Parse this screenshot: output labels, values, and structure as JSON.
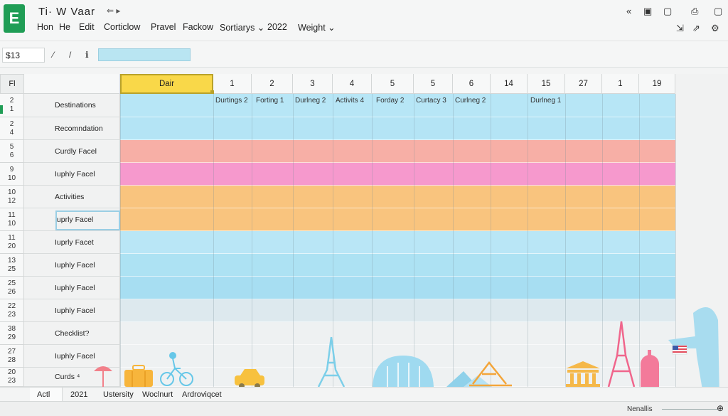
{
  "app": {
    "logo_letter": "E",
    "doc_title": "Ti· W  Vaar",
    "title_arrow": "⇐  ▸"
  },
  "menu": [
    {
      "label": "Hon"
    },
    {
      "label": "He"
    },
    {
      "label": "Edit"
    },
    {
      "label": "Corticlow"
    },
    {
      "label": "Pravel"
    },
    {
      "label": "Fackow"
    },
    {
      "label": "Sortiarys ⌄"
    },
    {
      "label": "2022"
    },
    {
      "label": "Weight ⌄"
    }
  ],
  "window_controls": [
    "«",
    "▣",
    "▢",
    "⎙",
    "▢"
  ],
  "right_tools": [
    "⇲",
    "⇗",
    "⚙"
  ],
  "formula_bar": {
    "cell_ref": "$13",
    "icons": [
      "⁄",
      "/",
      "ℹ"
    ],
    "value": ""
  },
  "columns": {
    "corner": "Fl",
    "a": "",
    "headers": [
      "Dair",
      "1",
      "2",
      "3",
      "4",
      "5",
      "5",
      "6",
      "14",
      "15",
      "27",
      "1",
      "19"
    ]
  },
  "row_headers": [
    [
      "2",
      "1"
    ],
    [
      "2",
      "4"
    ],
    [
      "5",
      "6"
    ],
    [
      "9",
      "10"
    ],
    [
      "10",
      "12"
    ],
    [
      "11",
      "10"
    ],
    [
      "11",
      "20"
    ],
    [
      "13",
      "25"
    ],
    [
      "25",
      "26"
    ],
    [
      "22",
      "23"
    ],
    [
      "38",
      "29"
    ],
    [
      "27",
      "28"
    ],
    [
      "20",
      "23"
    ]
  ],
  "row_labels": [
    "Destinations",
    "Recomndation",
    "Curdly Facel",
    "Iuphly Facel",
    "Activities",
    "Iuprly Facel",
    "Iuprly Facet",
    "Iuphly Facel",
    "Iuphly Facel",
    "Iuphly Facel",
    "Checklist?",
    "Iuphly Facel",
    "Curds ⁴"
  ],
  "row1_cells": [
    {
      "col": 1,
      "text": "Durtings 2"
    },
    {
      "col": 2,
      "text": "Forting 1"
    },
    {
      "col": 3,
      "text": "Durlneg 2"
    },
    {
      "col": 4,
      "text": "Activits 4"
    },
    {
      "col": 5,
      "text": "Forday 2"
    },
    {
      "col": 6,
      "text": "Curtacy 3"
    },
    {
      "col": 7,
      "text": "Curlneg 2"
    },
    {
      "col": 9,
      "text": "Durlneg 1"
    }
  ],
  "bands": [
    {
      "color": "#b7e6f6"
    },
    {
      "color": "#b4e4f5"
    },
    {
      "color": "#f7afa6"
    },
    {
      "color": "#f699cd"
    },
    {
      "color": "#f9c47e"
    },
    {
      "color": "#f9c47e"
    },
    {
      "color": "#b9e6f6"
    },
    {
      "color": "#ade2f3"
    },
    {
      "color": "#a7def2"
    },
    {
      "color": "#dde9ee"
    },
    {
      "color": "#eef1f2"
    },
    {
      "color": "#eef1f2"
    },
    {
      "color": "#eef1f2"
    }
  ],
  "sheet_tabs": [
    "Actl",
    "2021",
    "Ustersity",
    "Woclnurt",
    "Ardroviqcet"
  ],
  "status": {
    "text": "Nenallis",
    "right_arrow": "⊕"
  }
}
